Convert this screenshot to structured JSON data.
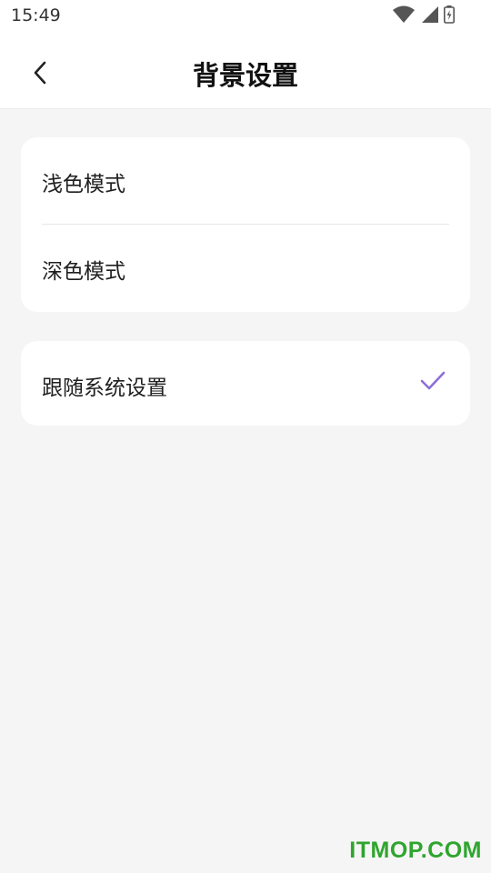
{
  "status_bar": {
    "time": "15:49",
    "icons": [
      "wifi-icon",
      "cellular-signal-icon",
      "battery-charging-icon"
    ]
  },
  "header": {
    "back_icon": "chevron-left-icon",
    "title": "背景设置"
  },
  "groups": [
    {
      "options": [
        {
          "label": "浅色模式",
          "selected": false
        },
        {
          "label": "深色模式",
          "selected": false
        }
      ]
    },
    {
      "options": [
        {
          "label": "跟随系统设置",
          "selected": true
        }
      ]
    }
  ],
  "colors": {
    "accent": "#8b6fd6",
    "background": "#f5f5f5",
    "card": "#ffffff"
  },
  "watermark": "ITMOP.COM"
}
